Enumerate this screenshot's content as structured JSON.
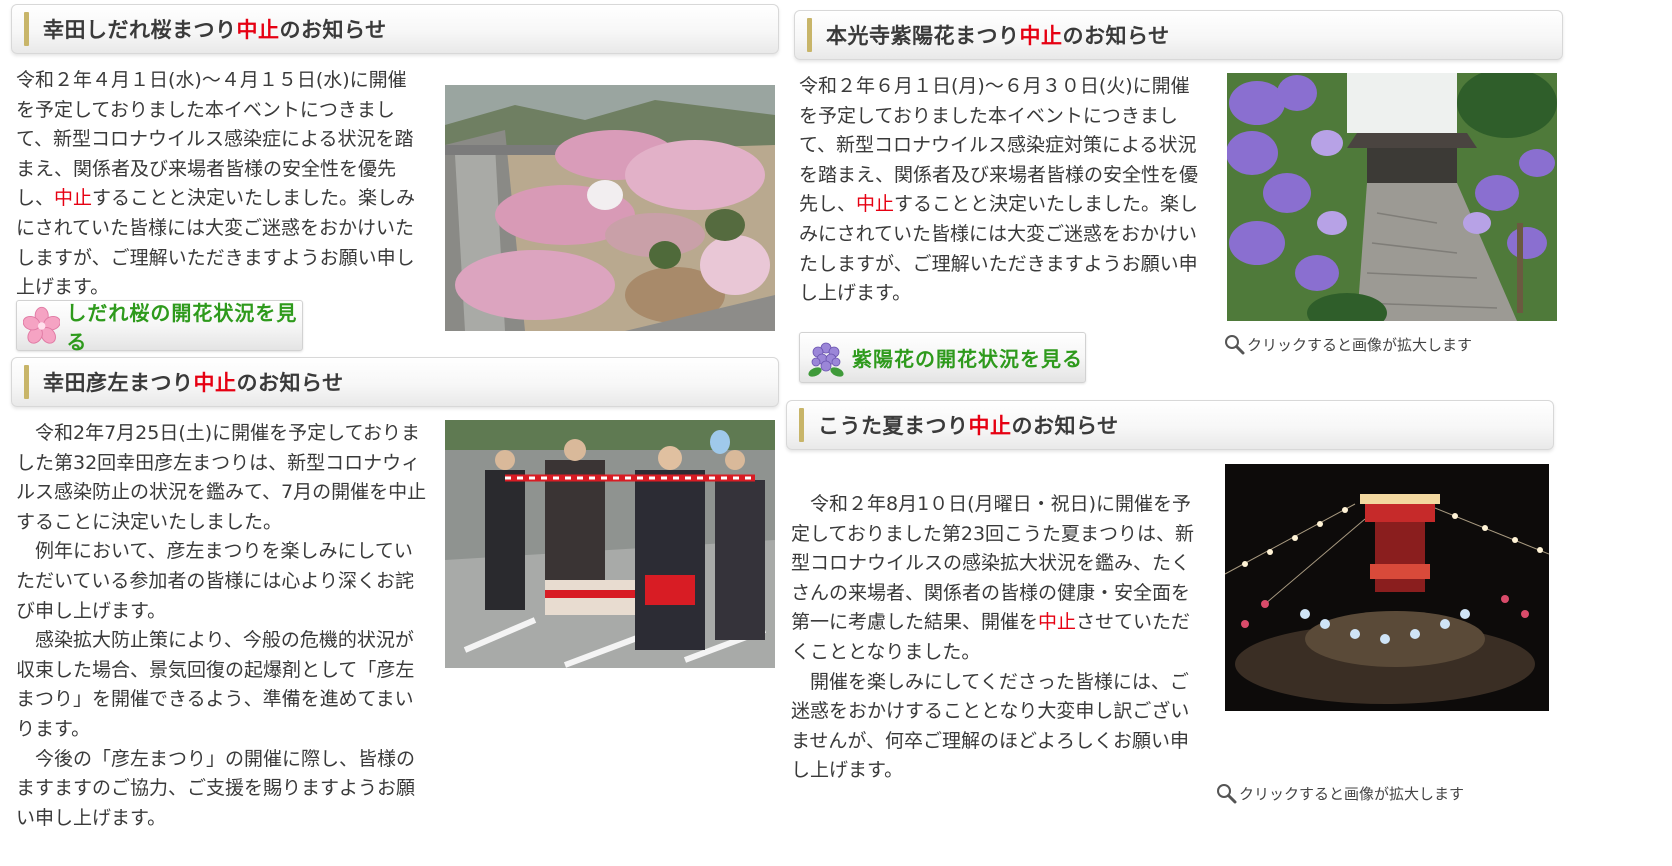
{
  "sections": {
    "shidare": {
      "title_pre": "幸田しだれ桜まつり",
      "title_red": "中止",
      "title_post": "のお知らせ",
      "lines": [
        "令和２年４月１日(水)～４月１５日(水)に開催",
        "を予定しておりました本イベントにつきまし",
        "て、新型コロナウイルス感染症による状況を踏",
        "まえ、関係者及び来場者皆様の安全性を優先"
      ],
      "line5_pre": "し、",
      "line5_red": "中止",
      "line5_post": "することと決定いたしました。楽しみ",
      "lines_after": [
        "にされていた皆様には大変ご迷惑をおかけいた",
        "しますが、ご理解いただきますようお願い申し",
        "上げます。"
      ],
      "button_label": "しだれ桜の開花状況を見る"
    },
    "hikoza": {
      "title_pre": "幸田彦左まつり",
      "title_red": "中止",
      "title_post": "のお知らせ",
      "lines": [
        "　令和2年7月25日(土)に開催を予定しておりま",
        "した第32回幸田彦左まつりは、新型コロナウィ",
        "ルス感染防止の状況を鑑みて、7月の開催を中止",
        "することに決定いたしました。",
        "　例年において、彦左まつりを楽しみにしてい",
        "ただいている参加者の皆様には心より深くお詫",
        "び申し上げます。",
        "　感染拡大防止策により、今般の危機的状況が",
        "収束した場合、景気回復の起爆剤として「彦左",
        "まつり」を開催できるよう、準備を進めてまい",
        "ります。",
        "　今後の「彦左まつり」の開催に際し、皆様の",
        "ますますのご協力、ご支援を賜りますようお願",
        "い申し上げます。"
      ]
    },
    "ajisai": {
      "title_pre": "本光寺紫陽花まつり",
      "title_red": "中止",
      "title_post": "のお知らせ",
      "lines": [
        "令和２年６月１日(月)～６月３０日(火)に開催",
        "を予定しておりました本イベントにつきまし",
        "て、新型コロナウイルス感染症対策による状況",
        "を踏まえ、関係者及び来場者皆様の安全性を優"
      ],
      "line5_pre": "先し、",
      "line5_red": "中止",
      "line5_post": "することと決定いたしました。楽し",
      "lines_after": [
        "みにされていた皆様には大変ご迷惑をおかけい",
        "たしますが、ご理解いただきますようお願い申",
        "し上げます。"
      ],
      "button_label": "紫陽花の開花状況を見る",
      "zoom_hint": "クリックすると画像が拡大します"
    },
    "kouta": {
      "title_pre": "こうた夏まつり",
      "title_red": "中止",
      "title_post": "のお知らせ",
      "lines": [
        "　令和２年8月1０日(月曜日・祝日)に開催を予",
        "定しておりました第23回こうた夏まつりは、新",
        "型コロナウイルスの感染拡大状況を鑑み、たく",
        "さんの来場者、関係者の皆様の健康・安全面を"
      ],
      "line5_pre": "第一に考慮した結果、開催を",
      "line5_red": "中止",
      "line5_post": "させていただ",
      "lines_after": [
        "くこととなりました。",
        "　開催を楽しみにしてくださった皆様には、ご",
        "迷惑をおかけすることとなり大変申し訳ござい",
        "ませんが、何卒ご理解のほどよろしくお願い申",
        "し上げます。"
      ],
      "zoom_hint": "クリックすると画像が拡大します"
    }
  },
  "colors": {
    "accent_red": "#e60012",
    "heading_bar": "#c8b569",
    "button_text": "#2e9a1c"
  },
  "icons": {
    "shidare_button": "cherry-blossom-icon",
    "ajisai_button": "hydrangea-icon",
    "zoom_hint": "magnifier-icon"
  }
}
